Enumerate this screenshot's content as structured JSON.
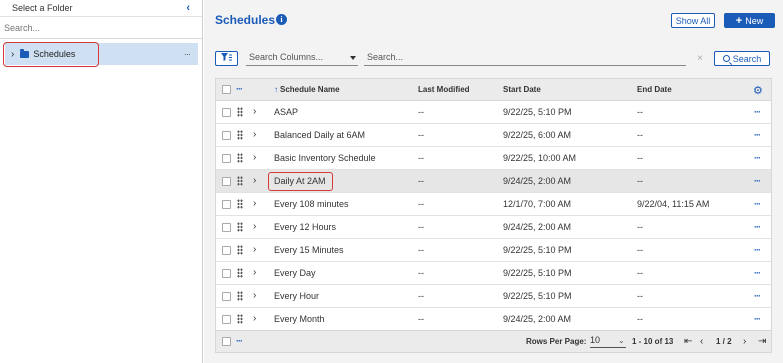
{
  "sidebar": {
    "title": "Select a Folder",
    "collapse_icon": "chevron-left-icon",
    "search_placeholder": "Search...",
    "tree": [
      {
        "label": "Schedules",
        "icon": "folder-icon",
        "expanded": false,
        "selected": true
      }
    ],
    "more_label": "···"
  },
  "header": {
    "title": "Schedules",
    "info_label": "i",
    "show_all_label": "Show All",
    "new_label": "New",
    "new_icon": "+"
  },
  "toolbar": {
    "filter_icon": "filter-icon",
    "search_columns_placeholder": "Search Columns...",
    "search_placeholder": "Search...",
    "clear_label": "×",
    "search_button_label": "Search"
  },
  "table": {
    "columns": {
      "more": "···",
      "name": "Schedule Name",
      "last_modified": "Last Modified",
      "start_date": "Start Date",
      "end_date": "End Date"
    },
    "sort_indicator": "↑",
    "rows": [
      {
        "name": "ASAP",
        "last_modified": "--",
        "start_date": "9/22/25, 5:10 PM",
        "end_date": "--"
      },
      {
        "name": "Balanced Daily at 6AM",
        "last_modified": "--",
        "start_date": "9/22/25, 6:00 AM",
        "end_date": "--"
      },
      {
        "name": "Basic Inventory Schedule",
        "last_modified": "--",
        "start_date": "9/22/25, 10:00 AM",
        "end_date": "--"
      },
      {
        "name": "Daily At 2AM",
        "last_modified": "--",
        "start_date": "9/24/25, 2:00 AM",
        "end_date": "--",
        "selected": true
      },
      {
        "name": "Every 108 minutes",
        "last_modified": "--",
        "start_date": "12/1/70, 7:00 AM",
        "end_date": "9/22/04, 11:15 AM"
      },
      {
        "name": "Every 12 Hours",
        "last_modified": "--",
        "start_date": "9/24/25, 2:00 AM",
        "end_date": "--"
      },
      {
        "name": "Every 15 Minutes",
        "last_modified": "--",
        "start_date": "9/22/25, 5:10 PM",
        "end_date": "--"
      },
      {
        "name": "Every Day",
        "last_modified": "--",
        "start_date": "9/22/25, 5:10 PM",
        "end_date": "--"
      },
      {
        "name": "Every Hour",
        "last_modified": "--",
        "start_date": "9/22/25, 5:10 PM",
        "end_date": "--"
      },
      {
        "name": "Every Month",
        "last_modified": "--",
        "start_date": "9/24/25, 2:00 AM",
        "end_date": "--"
      }
    ],
    "row_more_label": "···"
  },
  "footer": {
    "more_label": "···",
    "rows_per_page_label": "Rows Per Page:",
    "rows_per_page_value": "10",
    "range_label": "1 - 10 of 13",
    "page_label": "1 / 2",
    "first_icon": "first-page-icon",
    "prev_icon": "prev-page-icon",
    "next_icon": "next-page-icon",
    "last_icon": "last-page-icon"
  },
  "colors": {
    "accent": "#1a5bb8",
    "highlight": "#d23b3b",
    "selected_tree": "#cfe0f2"
  }
}
